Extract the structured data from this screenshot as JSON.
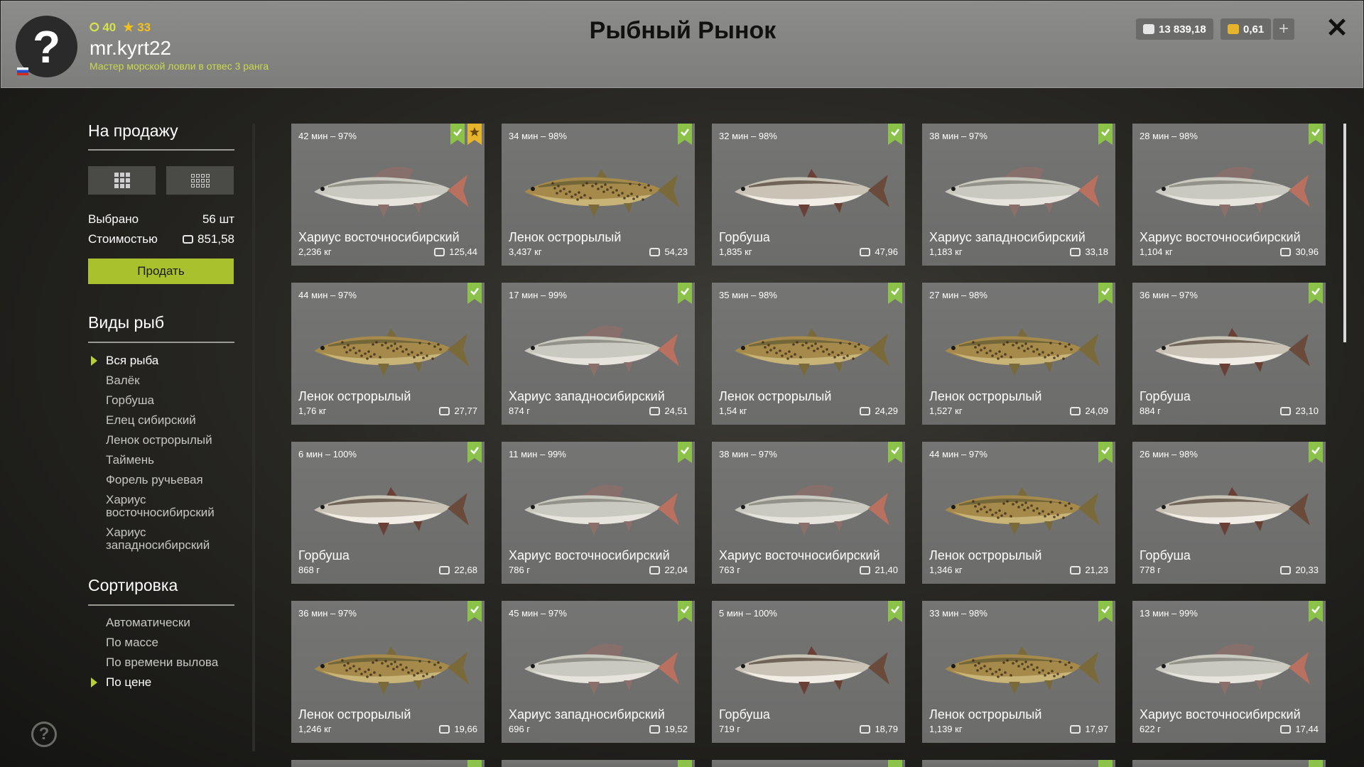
{
  "header": {
    "title": "Рыбный Рынок",
    "level": "40",
    "stars": "33",
    "username": "mr.kyrt22",
    "rank": "Мастер морской ловли в отвес 3 ранга",
    "silver": "13 839,18",
    "gold": "0,61",
    "plus": "+",
    "close": "✕",
    "avatar": "?"
  },
  "sidebar": {
    "sale_title": "На продажу",
    "selected_label": "Выбрано",
    "selected_value": "56 шт",
    "cost_label": "Стоимостью",
    "cost_value": "851,58",
    "sell_button": "Продать",
    "species_title": "Виды рыб",
    "species": [
      {
        "label": "Вся рыба",
        "active": true
      },
      {
        "label": "Валёк",
        "active": false
      },
      {
        "label": "Горбуша",
        "active": false
      },
      {
        "label": "Елец сибирский",
        "active": false
      },
      {
        "label": "Ленок острорылый",
        "active": false
      },
      {
        "label": "Таймень",
        "active": false
      },
      {
        "label": "Форель ручьевая",
        "active": false
      },
      {
        "label": "Хариус восточносибирский",
        "active": false
      },
      {
        "label": "Хариус западносибирский",
        "active": false
      }
    ],
    "sort_title": "Сортировка",
    "sort": [
      {
        "label": "Автоматически",
        "active": false
      },
      {
        "label": "По массе",
        "active": false
      },
      {
        "label": "По времени вылова",
        "active": false
      },
      {
        "label": "По цене",
        "active": true
      }
    ],
    "help": "?"
  },
  "colors": {
    "accent": "#a8c12c",
    "check_badge": "#8bc34a",
    "star_badge": "#e7b52c"
  },
  "cards": [
    {
      "time": "42 мин – 97%",
      "name": "Хариус восточносибирский",
      "weight": "2,236 кг",
      "price": "125,44",
      "fish": "grayling",
      "star": true
    },
    {
      "time": "34 мин – 98%",
      "name": "Ленок острорылый",
      "weight": "3,437 кг",
      "price": "54,23",
      "fish": "lenok",
      "star": false
    },
    {
      "time": "32 мин – 98%",
      "name": "Горбуша",
      "weight": "1,835 кг",
      "price": "47,96",
      "fish": "salmon",
      "star": false
    },
    {
      "time": "38 мин – 97%",
      "name": "Хариус западносибирский",
      "weight": "1,183 кг",
      "price": "33,18",
      "fish": "grayling",
      "star": false
    },
    {
      "time": "28 мин – 98%",
      "name": "Хариус восточносибирский",
      "weight": "1,104 кг",
      "price": "30,96",
      "fish": "grayling",
      "star": false
    },
    {
      "time": "44 мин – 97%",
      "name": "Ленок острорылый",
      "weight": "1,76 кг",
      "price": "27,77",
      "fish": "lenok",
      "star": false
    },
    {
      "time": "17 мин – 99%",
      "name": "Хариус западносибирский",
      "weight": "874 г",
      "price": "24,51",
      "fish": "grayling",
      "star": false
    },
    {
      "time": "35 мин – 98%",
      "name": "Ленок острорылый",
      "weight": "1,54 кг",
      "price": "24,29",
      "fish": "lenok",
      "star": false
    },
    {
      "time": "27 мин – 98%",
      "name": "Ленок острорылый",
      "weight": "1,527 кг",
      "price": "24,09",
      "fish": "lenok",
      "star": false
    },
    {
      "time": "36 мин – 97%",
      "name": "Горбуша",
      "weight": "884 г",
      "price": "23,10",
      "fish": "salmon",
      "star": false
    },
    {
      "time": "6 мин – 100%",
      "name": "Горбуша",
      "weight": "868 г",
      "price": "22,68",
      "fish": "salmon",
      "star": false
    },
    {
      "time": "11 мин – 99%",
      "name": "Хариус восточносибирский",
      "weight": "786 г",
      "price": "22,04",
      "fish": "grayling",
      "star": false
    },
    {
      "time": "38 мин – 97%",
      "name": "Хариус восточносибирский",
      "weight": "763 г",
      "price": "21,40",
      "fish": "grayling",
      "star": false
    },
    {
      "time": "44 мин – 97%",
      "name": "Ленок острорылый",
      "weight": "1,346 кг",
      "price": "21,23",
      "fish": "lenok",
      "star": false
    },
    {
      "time": "26 мин – 98%",
      "name": "Горбуша",
      "weight": "778 г",
      "price": "20,33",
      "fish": "salmon",
      "star": false
    },
    {
      "time": "36 мин – 97%",
      "name": "Ленок острорылый",
      "weight": "1,246 кг",
      "price": "19,66",
      "fish": "lenok",
      "star": false
    },
    {
      "time": "45 мин – 97%",
      "name": "Хариус западносибирский",
      "weight": "696 г",
      "price": "19,52",
      "fish": "grayling",
      "star": false
    },
    {
      "time": "5 мин – 100%",
      "name": "Горбуша",
      "weight": "719 г",
      "price": "18,79",
      "fish": "salmon",
      "star": false
    },
    {
      "time": "33 мин – 98%",
      "name": "Ленок острорылый",
      "weight": "1,139 кг",
      "price": "17,97",
      "fish": "lenok",
      "star": false
    },
    {
      "time": "13 мин – 99%",
      "name": "Хариус восточносибирский",
      "weight": "622 г",
      "price": "17,44",
      "fish": "grayling",
      "star": false
    }
  ]
}
